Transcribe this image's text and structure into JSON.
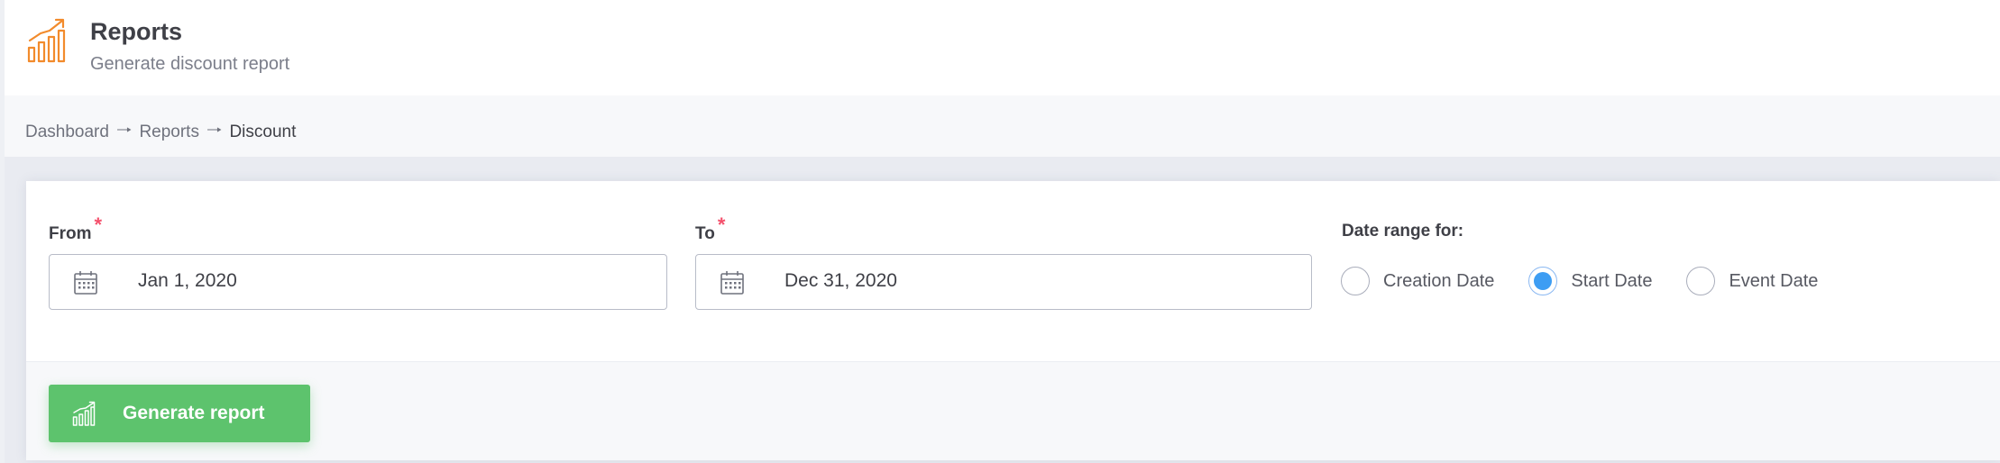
{
  "header": {
    "title": "Reports",
    "subtitle": "Generate discount report",
    "icon": "bar-chart-growth-icon",
    "accent": "#f28b2c"
  },
  "breadcrumb": {
    "items": [
      "Dashboard",
      "Reports",
      "Discount"
    ],
    "separator": "🠒"
  },
  "form": {
    "from": {
      "label": "From",
      "required_mark": "*",
      "value": "Jan 1, 2020",
      "icon": "calendar-icon"
    },
    "to": {
      "label": "To",
      "required_mark": "*",
      "value": "Dec 31, 2020",
      "icon": "calendar-icon"
    },
    "date_range": {
      "label": "Date range for:",
      "options": [
        "Creation Date",
        "Start Date",
        "Event Date"
      ],
      "selected": "Start Date"
    }
  },
  "actions": {
    "generate_label": "Generate report",
    "generate_icon": "bar-chart-growth-icon",
    "button_color": "#5dc36d"
  }
}
